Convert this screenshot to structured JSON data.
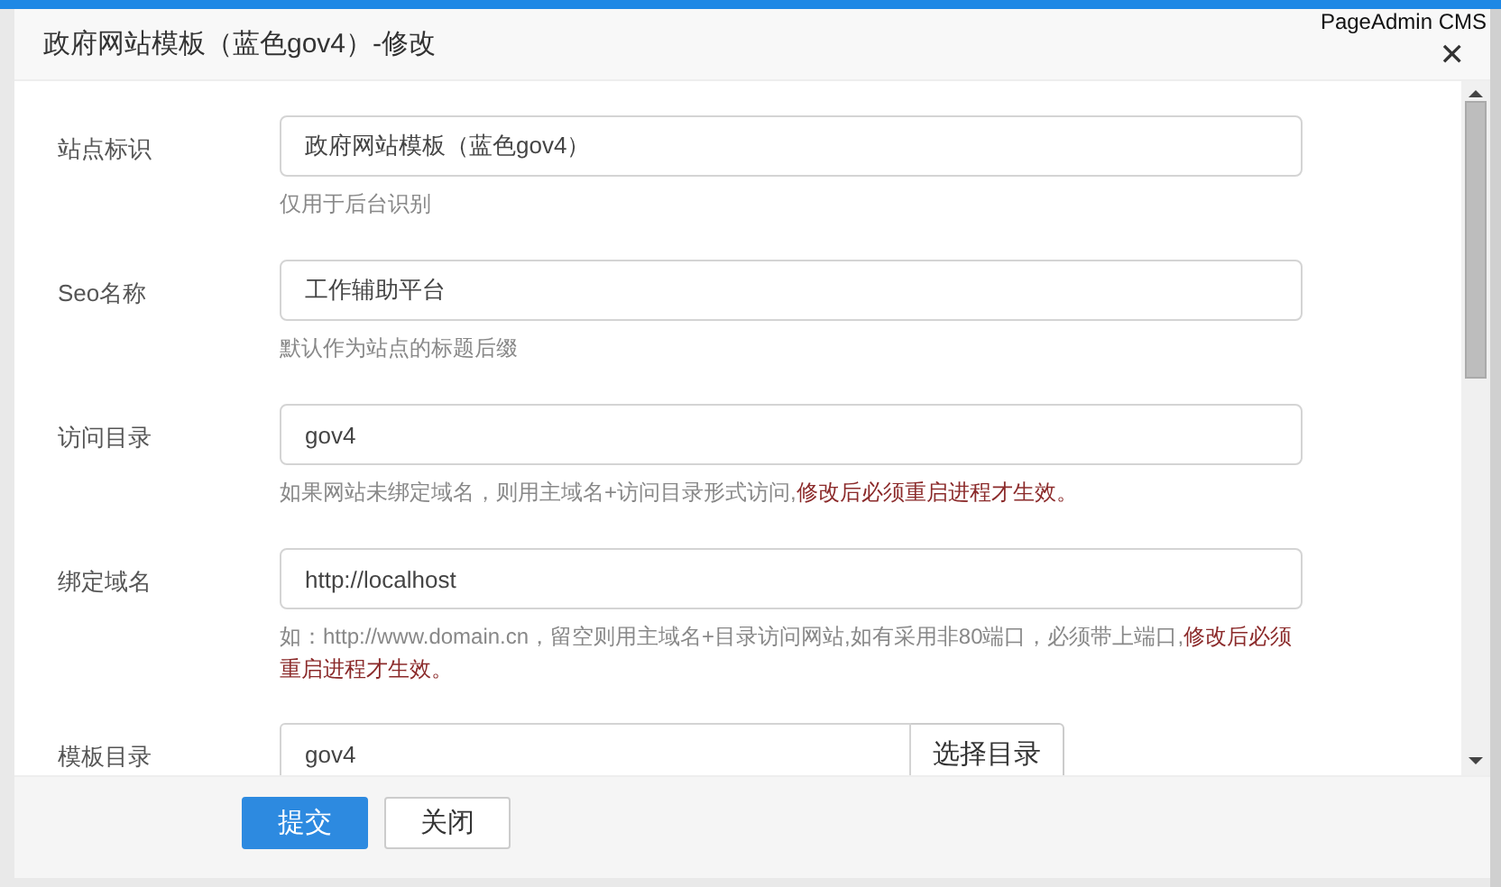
{
  "brand": "PageAdmin CMS",
  "dialog": {
    "title": "政府网站模板（蓝色gov4）-修改",
    "close": "✕"
  },
  "fields": [
    {
      "kind": "text",
      "label": "站点标识",
      "value": "政府网站模板（蓝色gov4）",
      "hint": "仅用于后台识别"
    },
    {
      "kind": "text",
      "label": "Seo名称",
      "value": "工作辅助平台",
      "hint": "默认作为站点的标题后缀"
    },
    {
      "kind": "text",
      "label": "访问目录",
      "value": "gov4",
      "hint": "如果网站未绑定域名，则用主域名+访问目录形式访问,",
      "warning": "修改后必须重启进程才生效。"
    },
    {
      "kind": "text",
      "label": "绑定域名",
      "value": "http://localhost",
      "hint": "如：http://www.domain.cn，留空则用主域名+目录访问网站,如有采用非80端口，必须带上端口,",
      "warning": "修改后必须重启进程才生效。"
    },
    {
      "kind": "picker",
      "label": "模板目录",
      "value": "gov4",
      "button": "选择目录"
    }
  ],
  "buttons": [
    {
      "label": "提交",
      "primary": true
    },
    {
      "label": "关闭",
      "primary": false
    }
  ]
}
